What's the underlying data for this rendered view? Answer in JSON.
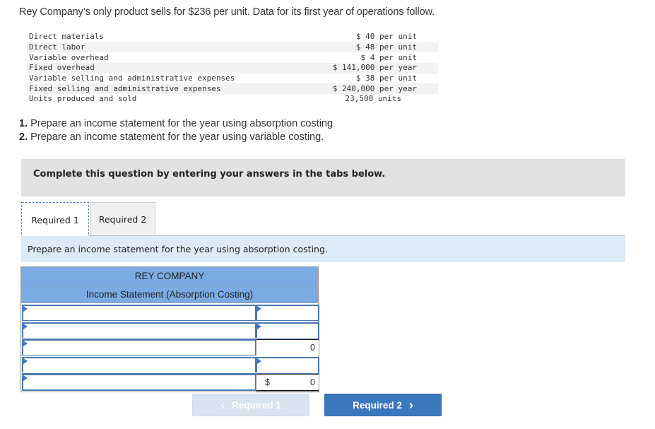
{
  "intro": "Rey Company’s only product sells for $236 per unit. Data for its first year of operations follow.",
  "cost_data": [
    {
      "label": "Direct materials",
      "value": "$ 40 per unit"
    },
    {
      "label": "Direct labor",
      "value": "$ 48 per unit"
    },
    {
      "label": "Variable overhead",
      "value": "$ 4 per unit"
    },
    {
      "label": "Fixed overhead",
      "value": "$ 141,000 per year"
    },
    {
      "label": "Variable selling and administrative expenses",
      "value": "$ 38 per unit"
    },
    {
      "label": "Fixed selling and administrative expenses",
      "value": "$ 240,000 per year"
    },
    {
      "label": "Units produced and sold",
      "value": "23,500 units"
    }
  ],
  "questions": [
    {
      "num": "1.",
      "text": " Prepare an income statement for the year using absorption costing"
    },
    {
      "num": "2.",
      "text": " Prepare an income statement for the year using variable costing."
    }
  ],
  "banner": "Complete this question by entering your answers in the tabs below.",
  "tabs": [
    {
      "label": "Required 1",
      "active": true
    },
    {
      "label": "Required 2",
      "active": false
    }
  ],
  "instruction": "Prepare an income statement for the year using absorption costing.",
  "statement": {
    "company": "REY COMPANY",
    "title": "Income Statement (Absorption Costing)",
    "rows": [
      {
        "label": "",
        "amount": "",
        "editable": true
      },
      {
        "label": "",
        "amount": "",
        "editable": true
      },
      {
        "label": "",
        "amount": "0",
        "editable": false
      },
      {
        "label": "",
        "amount": "",
        "editable": true
      },
      {
        "label": "",
        "currency": "$",
        "amount": "0",
        "editable": false
      }
    ]
  },
  "nav": {
    "prev_label": "Required 1",
    "next_label": "Required 2",
    "prev_icon": "‹",
    "next_icon": "›"
  },
  "colors": {
    "header_blue": "#7aabe3",
    "button_blue": "#3b77bd",
    "instruction_bg": "#ddeaf7"
  }
}
